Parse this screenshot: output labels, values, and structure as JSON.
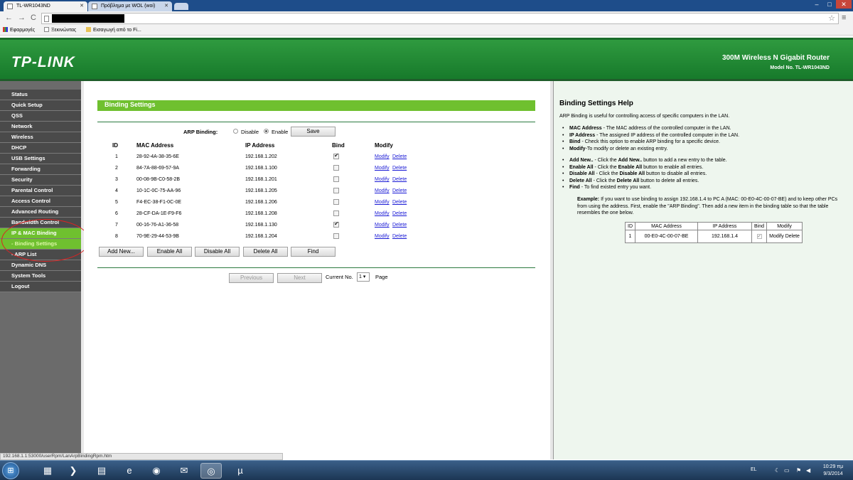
{
  "browser": {
    "tabs": [
      {
        "label": "TL-WR1043ND"
      },
      {
        "label": "Πρόβλημα με WOL (woi)"
      }
    ],
    "bookmarks": [
      {
        "label": "Εφαρμογές"
      },
      {
        "label": "Ξεκινώντας"
      },
      {
        "label": "Εισαγωγή από το Fi..."
      }
    ],
    "status_url": "192.168.1.1:53000/userRpm/LanArpBindingRpm.htm"
  },
  "router": {
    "logo": "TP-LINK",
    "name": "300M Wireless N Gigabit Router",
    "model": "Model No. TL-WR1043ND"
  },
  "sidebar": {
    "items": [
      {
        "label": "Status"
      },
      {
        "label": "Quick Setup"
      },
      {
        "label": "QSS"
      },
      {
        "label": "Network"
      },
      {
        "label": "Wireless"
      },
      {
        "label": "DHCP"
      },
      {
        "label": "USB Settings"
      },
      {
        "label": "Forwarding"
      },
      {
        "label": "Security"
      },
      {
        "label": "Parental Control"
      },
      {
        "label": "Access Control"
      },
      {
        "label": "Advanced Routing"
      },
      {
        "label": "Bandwidth Control"
      },
      {
        "label": "IP & MAC Binding"
      },
      {
        "label": "- Binding Settings"
      },
      {
        "label": "- ARP List"
      },
      {
        "label": "Dynamic DNS"
      },
      {
        "label": "System Tools"
      },
      {
        "label": "Logout"
      }
    ]
  },
  "main": {
    "title": "Binding Settings",
    "arp_label": "ARP Binding:",
    "disable_label": "Disable",
    "enable_label": "Enable",
    "arp_binding_enabled": true,
    "save_label": "Save",
    "columns": [
      "ID",
      "MAC Address",
      "IP Address",
      "Bind",
      "Modify"
    ],
    "rows": [
      {
        "id": "1",
        "mac": "28-92-4A-38-35-6E",
        "ip": "192.168.1.202",
        "bind": true,
        "modify": "Modify",
        "delete": "Delete"
      },
      {
        "id": "2",
        "mac": "84-7A-88-69-57-9A",
        "ip": "192.168.1.100",
        "bind": false,
        "modify": "Modify",
        "delete": "Delete"
      },
      {
        "id": "3",
        "mac": "00-08-9B-C0-58-2B",
        "ip": "192.168.1.201",
        "bind": false,
        "modify": "Modify",
        "delete": "Delete"
      },
      {
        "id": "4",
        "mac": "10-1C-0C-75-AA-96",
        "ip": "192.168.1.205",
        "bind": false,
        "modify": "Modify",
        "delete": "Delete"
      },
      {
        "id": "5",
        "mac": "F4-EC-38-F1-0C-0E",
        "ip": "192.168.1.206",
        "bind": false,
        "modify": "Modify",
        "delete": "Delete"
      },
      {
        "id": "6",
        "mac": "28-CF-DA-1E-F9-F6",
        "ip": "192.168.1.208",
        "bind": false,
        "modify": "Modify",
        "delete": "Delete"
      },
      {
        "id": "7",
        "mac": "00-16-76-A1-36-58",
        "ip": "192.168.1.130",
        "bind": true,
        "modify": "Modify",
        "delete": "Delete"
      },
      {
        "id": "8",
        "mac": "70-9E-29-44-53-9B",
        "ip": "192.168.1.204",
        "bind": false,
        "modify": "Modify",
        "delete": "Delete"
      }
    ],
    "buttons": {
      "add": "Add New...",
      "enable_all": "Enable All",
      "disable_all": "Disable All",
      "delete_all": "Delete All",
      "find": "Find"
    },
    "pager": {
      "previous": "Previous",
      "next": "Next",
      "current_label": "Current No.",
      "current_value": "1",
      "page_label": "Page"
    }
  },
  "help": {
    "title": "Binding Settings Help",
    "intro": "ARP Binding is useful for controlling access of specific computers in the LAN.",
    "fields": [
      {
        "term": "MAC Address",
        "text": " - The MAC address of the controlled computer in the LAN."
      },
      {
        "term": "IP Address",
        "text": " - The assigned IP address of the controlled computer in the LAN."
      },
      {
        "term": "Bind",
        "text": " - Check this option to enable ARP binding for a specific device."
      },
      {
        "term": "Modify",
        "text": "-To modify or delete an existing entry."
      }
    ],
    "actions": [
      {
        "term": "Add New..",
        "text": " - Click the ",
        "term2": "Add New..",
        "text2": " button to add a new entry to the table."
      },
      {
        "term": "Enable All",
        "text": " - Click the ",
        "term2": "Enable All",
        "text2": " button to enable all entries."
      },
      {
        "term": "Disable All",
        "text": " - Click the ",
        "term2": "Disable All",
        "text2": " button to disable all entries."
      },
      {
        "term": "Delete All",
        "text": " - Click the ",
        "term2": "Delete All",
        "text2": " button to delete all entries."
      },
      {
        "term": "Find",
        "text": " - To find existed entry you want.",
        "term2": "",
        "text2": ""
      }
    ],
    "example_label": "Example:",
    "example_text": " If you want to use binding to assign 192.168.1.4 to PC A (MAC: 00-E0-4C-00-07-BE) and to keep other PCs from using the address. First, enable the \"ARP Binding\". Then add a new item in the binding table so that the table resembles the one below.",
    "example_columns": [
      "ID",
      "MAC Address",
      "IP Address",
      "Bind",
      "Modify"
    ],
    "example_row": {
      "id": "1",
      "mac": "00-E0-4C-00-07-BE",
      "ip": "192.168.1.4",
      "modify": "Modify",
      "delete": "Delete"
    }
  },
  "taskbar": {
    "lang": "EL",
    "time": "10:29 πμ",
    "date": "9/3/2014"
  }
}
